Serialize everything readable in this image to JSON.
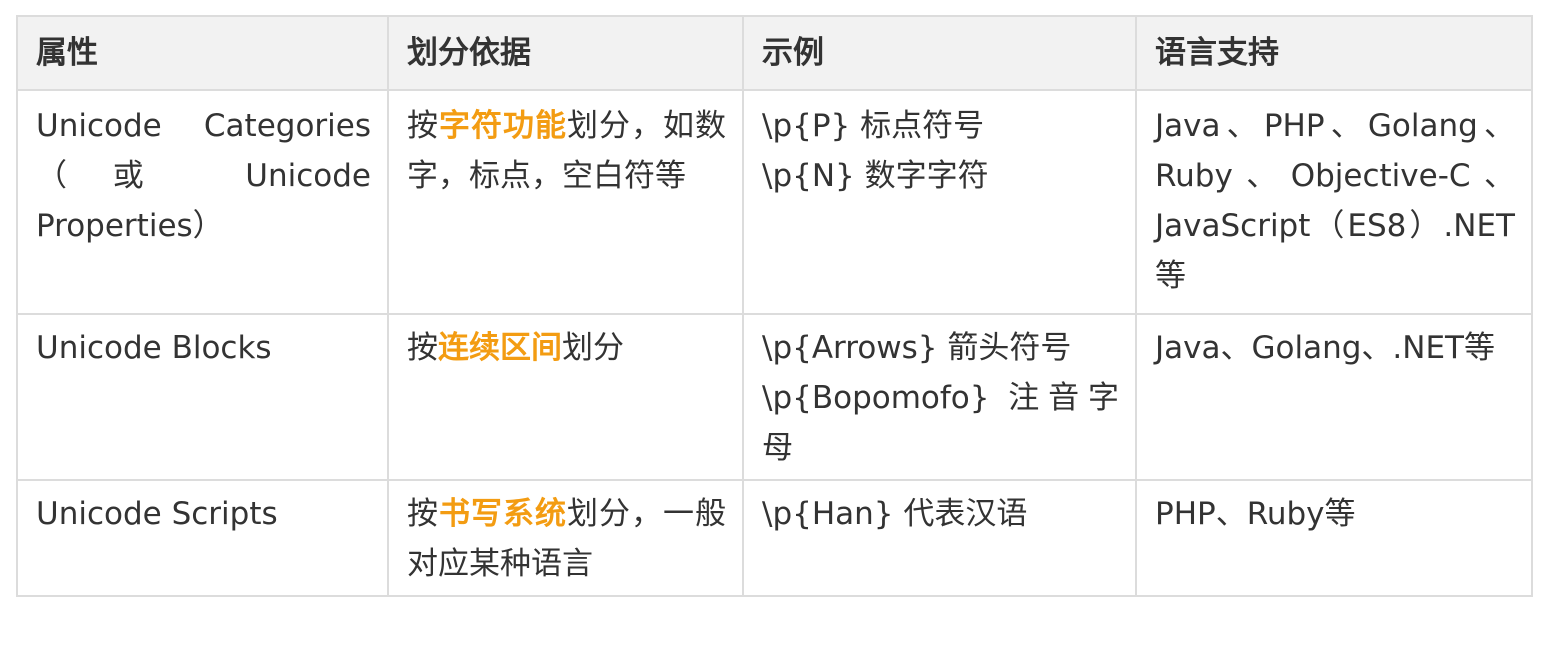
{
  "colors": {
    "text": "#333333",
    "header_bg": "#f2f2f2",
    "border": "#dcdcdc",
    "highlight": "#f39c12"
  },
  "table": {
    "headers": [
      "属性",
      "划分依据",
      "示例",
      "语言支持"
    ],
    "rows": [
      {
        "attribute": "Unicode Categories（或 Unicode Properties）",
        "basis_prefix": "按",
        "basis_highlight": "字符功能",
        "basis_suffix": "划分，如数字，标点，空白符等",
        "examples": [
          "\\p{P} 标点符号",
          "\\p{N} 数字字符"
        ],
        "languages": "Java、PHP、Golang、Ruby、Objective-C、JavaScript（ES8）.NET等"
      },
      {
        "attribute": "Unicode Blocks",
        "basis_prefix": "按",
        "basis_highlight": "连续区间",
        "basis_suffix": "划分",
        "examples": [
          "\\p{Arrows} 箭头符号",
          "\\p{Bopomofo} 注音字母"
        ],
        "languages": "Java、Golang、.NET等"
      },
      {
        "attribute": "Unicode Scripts",
        "basis_prefix": "按",
        "basis_highlight": "书写系统",
        "basis_suffix": "划分，一般对应某种语言",
        "examples": [
          "\\p{Han} 代表汉语"
        ],
        "languages": "PHP、Ruby等"
      }
    ]
  }
}
